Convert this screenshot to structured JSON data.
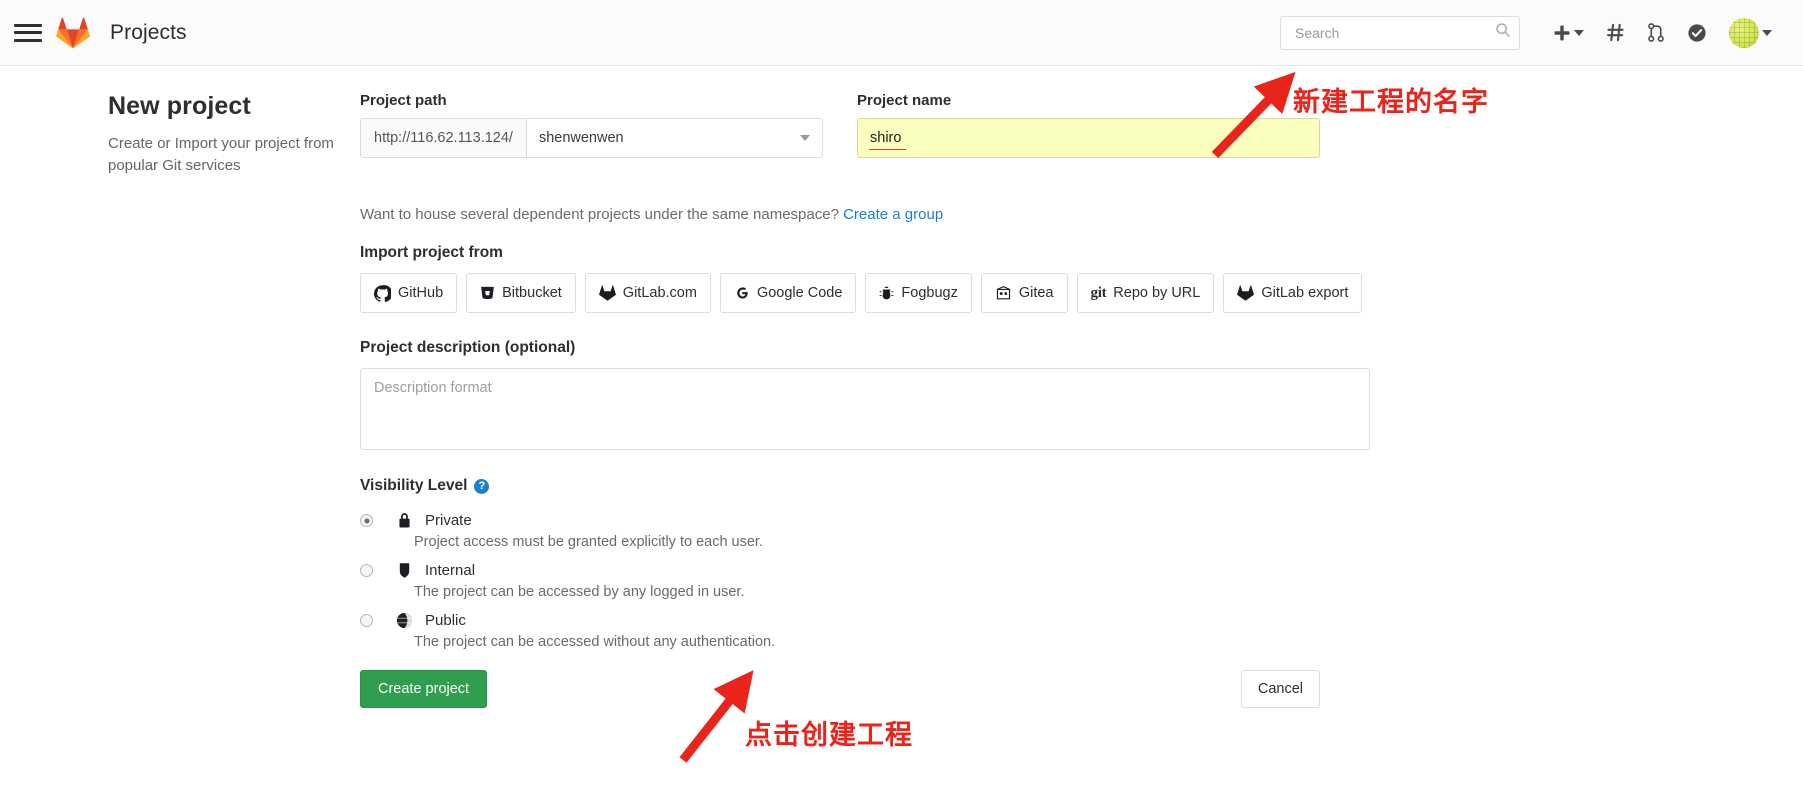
{
  "navbar": {
    "menu_icon": "hamburger-icon",
    "logo_icon": "gitlab-logo-icon",
    "title": "Projects",
    "search": {
      "placeholder": "Search",
      "value": "",
      "icon": "search-icon"
    },
    "icons": [
      {
        "name": "plus-icon",
        "glyph": "+",
        "has_caret": true
      },
      {
        "name": "hash-issues-icon",
        "glyph": "#",
        "has_caret": false
      },
      {
        "name": "merge-request-icon",
        "glyph": "merge",
        "has_caret": false
      },
      {
        "name": "todos-check-icon",
        "glyph": "check-circle",
        "has_caret": false
      }
    ],
    "avatar": {
      "name": "user-avatar",
      "has_caret": true
    }
  },
  "intro": {
    "heading": "New project",
    "description": "Create or Import your project from popular Git services"
  },
  "form": {
    "project_path_label": "Project path",
    "path_prefix": "http://116.62.113.124/",
    "namespace_value": "shenwenwen",
    "project_name_label": "Project name",
    "project_name_value": "shiro",
    "namespace_hint_text": "Want to house several dependent projects under the same namespace?",
    "namespace_hint_link": "Create a group",
    "import_label": "Import project from",
    "import_options": [
      {
        "label": "GitHub",
        "icon": "github-icon"
      },
      {
        "label": "Bitbucket",
        "icon": "bitbucket-icon"
      },
      {
        "label": "GitLab.com",
        "icon": "gitlab-icon"
      },
      {
        "label": "Google Code",
        "icon": "google-icon"
      },
      {
        "label": "Fogbugz",
        "icon": "bug-icon"
      },
      {
        "label": "Gitea",
        "icon": "gitea-icon"
      },
      {
        "label": "Repo by URL",
        "icon": "git-text-icon"
      },
      {
        "label": "GitLab export",
        "icon": "gitlab-icon"
      }
    ],
    "description_label": "Project description (optional)",
    "description_placeholder": "Description format",
    "description_value": "",
    "visibility_label": "Visibility Level",
    "visibility_help_glyph": "?",
    "visibility_options": [
      {
        "name": "Private",
        "icon": "lock-icon",
        "selected": true,
        "description": "Project access must be granted explicitly to each user."
      },
      {
        "name": "Internal",
        "icon": "shield-icon",
        "selected": false,
        "description": "The project can be accessed by any logged in user."
      },
      {
        "name": "Public",
        "icon": "globe-icon",
        "selected": false,
        "description": "The project can be accessed without any authentication."
      }
    ],
    "create_button": "Create project",
    "cancel_button": "Cancel"
  },
  "annotations": [
    {
      "text": "新建工程的名字",
      "color": "#e8241b"
    },
    {
      "text": "点击创建工程",
      "color": "#e8241b"
    }
  ],
  "colors": {
    "accent_green": "#2f9e4f",
    "link_blue": "#1b7fcc",
    "annotation_red": "#e8241b",
    "name_field_bg": "#faffbd"
  }
}
